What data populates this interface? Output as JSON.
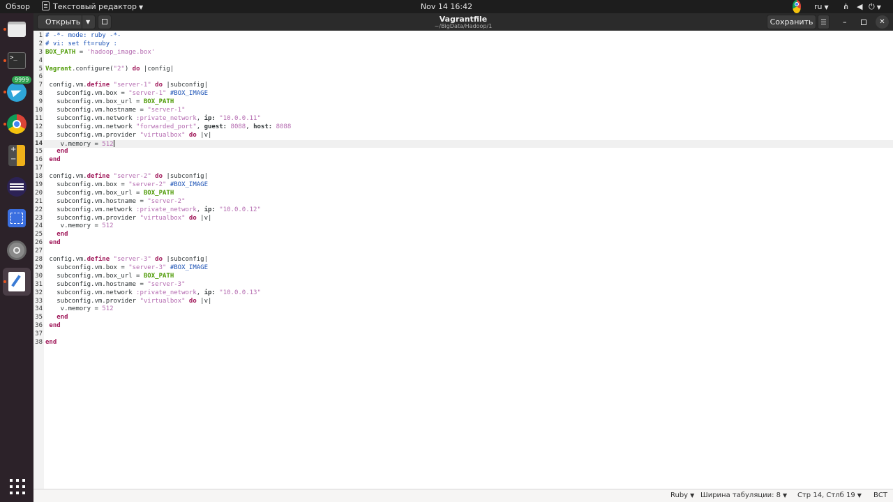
{
  "topbar": {
    "overview": "Обзор",
    "app_name": "Текстовый редактор",
    "clock": "Nov 14  16:42",
    "lang": "ru"
  },
  "dock": {
    "items": [
      "files",
      "terminal",
      "telegram",
      "chrome",
      "calculator",
      "eclipse",
      "screenshot",
      "settings",
      "text-editor"
    ],
    "telegram_badge": "9999",
    "terminal_glyph": ">_"
  },
  "headerbar": {
    "open_label": "Открыть",
    "title": "Vagrantfile",
    "subtitle": "~/BigData/Hadoop/1",
    "save_label": "Сохранить"
  },
  "editor": {
    "current_line": 14,
    "lines": [
      [
        [
          "com",
          "# -*- mode: ruby -*-"
        ]
      ],
      [
        [
          "com",
          "# vi: set ft=ruby :"
        ]
      ],
      [
        [
          "const",
          "BOX_PATH"
        ],
        [
          "plain",
          " = "
        ],
        [
          "str",
          "'hadoop_image.box'"
        ]
      ],
      [],
      [
        [
          "const",
          "Vagrant"
        ],
        [
          "plain",
          ".configure("
        ],
        [
          "str",
          "\"2\""
        ],
        [
          "plain",
          ") "
        ],
        [
          "kw",
          "do"
        ],
        [
          "plain",
          " |config|"
        ]
      ],
      [],
      [
        [
          "plain",
          " config.vm."
        ],
        [
          "kw",
          "define"
        ],
        [
          "plain",
          " "
        ],
        [
          "str",
          "\"server-1\""
        ],
        [
          "plain",
          " "
        ],
        [
          "kw",
          "do"
        ],
        [
          "plain",
          " |subconfig|"
        ]
      ],
      [
        [
          "plain",
          "   subconfig.vm.box = "
        ],
        [
          "str",
          "\"server-1\""
        ],
        [
          "plain",
          " "
        ],
        [
          "com",
          "#BOX_IMAGE"
        ]
      ],
      [
        [
          "plain",
          "   subconfig.vm.box_url = "
        ],
        [
          "const",
          "BOX_PATH"
        ]
      ],
      [
        [
          "plain",
          "   subconfig.vm.hostname = "
        ],
        [
          "str",
          "\"server-1\""
        ]
      ],
      [
        [
          "plain",
          "   subconfig.vm.network "
        ],
        [
          "sym",
          ":private_network"
        ],
        [
          "plain",
          ", "
        ],
        [
          "key",
          "ip:"
        ],
        [
          "plain",
          " "
        ],
        [
          "str",
          "\"10.0.0.11\""
        ]
      ],
      [
        [
          "plain",
          "   subconfig.vm.network "
        ],
        [
          "str",
          "\"forwarded_port\""
        ],
        [
          "plain",
          ", "
        ],
        [
          "key",
          "guest:"
        ],
        [
          "plain",
          " "
        ],
        [
          "num",
          "8088"
        ],
        [
          "plain",
          ", "
        ],
        [
          "key",
          "host:"
        ],
        [
          "plain",
          " "
        ],
        [
          "num",
          "8088"
        ]
      ],
      [
        [
          "plain",
          "   subconfig.vm.provider "
        ],
        [
          "str",
          "\"virtualbox\""
        ],
        [
          "plain",
          " "
        ],
        [
          "kw",
          "do"
        ],
        [
          "plain",
          " |v|"
        ]
      ],
      [
        [
          "plain",
          "    v.memory = "
        ],
        [
          "num",
          "512"
        ],
        [
          "cursor",
          ""
        ]
      ],
      [
        [
          "kw",
          "   end"
        ]
      ],
      [
        [
          "kw",
          " end"
        ]
      ],
      [],
      [
        [
          "plain",
          " config.vm."
        ],
        [
          "kw",
          "define"
        ],
        [
          "plain",
          " "
        ],
        [
          "str",
          "\"server-2\""
        ],
        [
          "plain",
          " "
        ],
        [
          "kw",
          "do"
        ],
        [
          "plain",
          " |subconfig|"
        ]
      ],
      [
        [
          "plain",
          "   subconfig.vm.box = "
        ],
        [
          "str",
          "\"server-2\""
        ],
        [
          "plain",
          " "
        ],
        [
          "com",
          "#BOX_IMAGE"
        ]
      ],
      [
        [
          "plain",
          "   subconfig.vm.box_url = "
        ],
        [
          "const",
          "BOX_PATH"
        ]
      ],
      [
        [
          "plain",
          "   subconfig.vm.hostname = "
        ],
        [
          "str",
          "\"server-2\""
        ]
      ],
      [
        [
          "plain",
          "   subconfig.vm.network "
        ],
        [
          "sym",
          ":private_network"
        ],
        [
          "plain",
          ", "
        ],
        [
          "key",
          "ip:"
        ],
        [
          "plain",
          " "
        ],
        [
          "str",
          "\"10.0.0.12\""
        ]
      ],
      [
        [
          "plain",
          "   subconfig.vm.provider "
        ],
        [
          "str",
          "\"virtualbox\""
        ],
        [
          "plain",
          " "
        ],
        [
          "kw",
          "do"
        ],
        [
          "plain",
          " |v|"
        ]
      ],
      [
        [
          "plain",
          "    v.memory = "
        ],
        [
          "num",
          "512"
        ]
      ],
      [
        [
          "kw",
          "   end"
        ]
      ],
      [
        [
          "kw",
          " end"
        ]
      ],
      [],
      [
        [
          "plain",
          " config.vm."
        ],
        [
          "kw",
          "define"
        ],
        [
          "plain",
          " "
        ],
        [
          "str",
          "\"server-3\""
        ],
        [
          "plain",
          " "
        ],
        [
          "kw",
          "do"
        ],
        [
          "plain",
          " |subconfig|"
        ]
      ],
      [
        [
          "plain",
          "   subconfig.vm.box = "
        ],
        [
          "str",
          "\"server-3\""
        ],
        [
          "plain",
          " "
        ],
        [
          "com",
          "#BOX_IMAGE"
        ]
      ],
      [
        [
          "plain",
          "   subconfig.vm.box_url = "
        ],
        [
          "const",
          "BOX_PATH"
        ]
      ],
      [
        [
          "plain",
          "   subconfig.vm.hostname = "
        ],
        [
          "str",
          "\"server-3\""
        ]
      ],
      [
        [
          "plain",
          "   subconfig.vm.network "
        ],
        [
          "sym",
          ":private_network"
        ],
        [
          "plain",
          ", "
        ],
        [
          "key",
          "ip:"
        ],
        [
          "plain",
          " "
        ],
        [
          "str",
          "\"10.0.0.13\""
        ]
      ],
      [
        [
          "plain",
          "   subconfig.vm.provider "
        ],
        [
          "str",
          "\"virtualbox\""
        ],
        [
          "plain",
          " "
        ],
        [
          "kw",
          "do"
        ],
        [
          "plain",
          " |v|"
        ]
      ],
      [
        [
          "plain",
          "    v.memory = "
        ],
        [
          "num",
          "512"
        ]
      ],
      [
        [
          "kw",
          "   end"
        ]
      ],
      [
        [
          "kw",
          " end"
        ]
      ],
      [],
      [
        [
          "kw",
          "end"
        ]
      ]
    ]
  },
  "statusbar": {
    "language": "Ruby",
    "tab_width": "Ширина табуляции: 8",
    "position": "Стр 14, Стлб 19",
    "insert_mode": "ВСТ"
  },
  "colors": {
    "accent": "#e95420",
    "comment": "#1a51b5",
    "string": "#b46ab0",
    "keyword": "#a0195a",
    "constant": "#4e9a06"
  }
}
